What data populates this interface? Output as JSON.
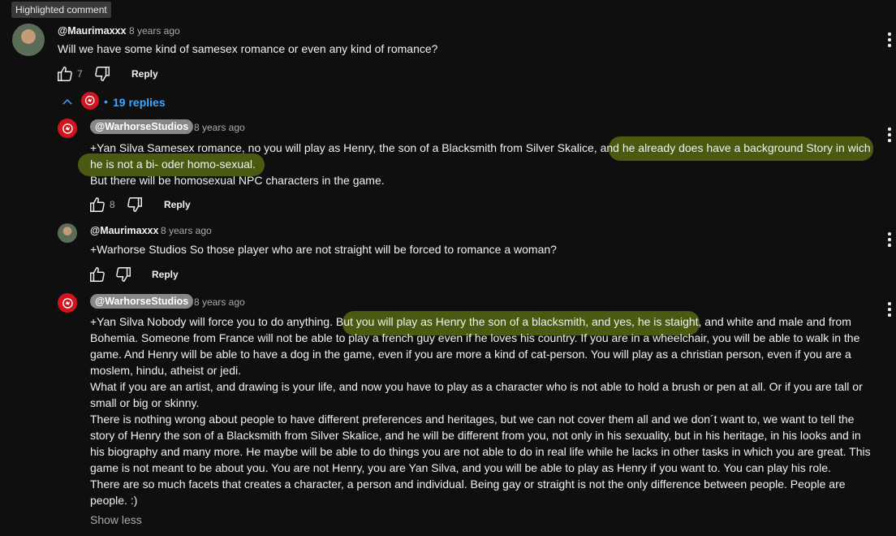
{
  "badge": "Highlighted comment",
  "top_comment": {
    "author": "@Maurimaxxx",
    "time": "8 years ago",
    "text": "Will we have some kind of samesex romance or even any kind of romance?",
    "likes": "7",
    "reply_label": "Reply"
  },
  "replies_toggle": {
    "label": "19 replies"
  },
  "replies": [
    {
      "author": "@WarhorseStudios",
      "time": "8 years ago",
      "lines": [
        "+Yan Silva Samesex romance, no you will play as Henry, the son of a Blacksmith from Silver Skalice, and he already does have a background Story in wich",
        "he is not a bi- oder homo-sexual.",
        "But there will be homosexual NPC characters in the game."
      ],
      "likes": "8",
      "reply_label": "Reply"
    },
    {
      "author": "@Maurimaxxx",
      "time": "8 years ago",
      "lines": [
        "+Warhorse Studios So those player who are not straight will be forced to romance a woman?"
      ],
      "likes": "",
      "reply_label": "Reply"
    },
    {
      "author": "@WarhorseStudios",
      "time": "8 years ago",
      "lines": [
        "+Yan Silva Nobody will force you to do anything. But you will play as Henry the son of a blacksmith, and yes, he is staight, and white and male and from",
        "Bohemia. Someone from France will not be able to play a french guy even if he loves his country. If you are in a wheelchair, you will be able to walk in the",
        "game. And Henry will be able to have a dog in the game, even if you are more a kind of cat-person. You will play as a christian person, even if you are a",
        "moslem, hindu, atheist or jedi.",
        "What if you are an artist, and drawing is your life, and now you have to play as a character who is not able to hold a brush or pen at all. Or if you are tall or",
        "small or big or skinny.",
        "There is nothing wrong about people to have different preferences and heritages, but we can not cover them all and we don´t want to, we want to tell the",
        "story of Henry the son of a Blacksmith from Silver Skalice, and he will be different from you, not only in his sexuality, but in his heritage, in his looks and in",
        "his biography and many more. He maybe will be able to do things you are not able to do in real life while he lacks in other tasks in which you are great. This",
        "game is not meant to be about you. You are not Henry, you are Yan Silva, and you will be able to play as Henry if you want to. You can play his role.",
        "There are so much facets that creates a character, a person and individual. Being gay or straight is not the only difference between people. People are",
        "people. :)"
      ],
      "show_less": "Show less"
    }
  ],
  "icons": {
    "like": "thumbs-up-icon",
    "dislike": "thumbs-down-icon",
    "menu": "kebab-menu-icon",
    "collapse": "chevron-up-icon",
    "studio_logo": "dragon-logo-icon"
  },
  "colors": {
    "background": "#0f0f0f",
    "link": "#3ea6ff",
    "highlight": "#4a5a10",
    "studio_red": "#d2141e"
  }
}
